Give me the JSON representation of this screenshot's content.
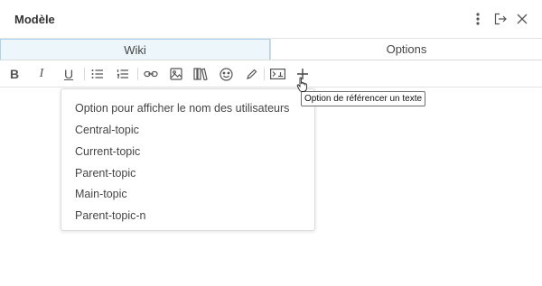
{
  "window": {
    "title": "Modèle",
    "icons": [
      "more-vertical-icon",
      "logout-icon",
      "close-icon"
    ]
  },
  "tabs": [
    {
      "label": "Wiki",
      "active": true
    },
    {
      "label": "Options",
      "active": false
    }
  ],
  "toolbar": {
    "bold": "B",
    "italic": "I",
    "underline": "U",
    "tools": [
      "bold-icon",
      "italic-icon",
      "underline-icon",
      "bullet-list-icon",
      "numbered-list-icon",
      "link-icon",
      "image-icon",
      "library-icon",
      "emoji-icon",
      "pencil-icon",
      "embed-icon",
      "plus-icon"
    ]
  },
  "tooltip": {
    "text": "Option de référencer un texte"
  },
  "dropdown": {
    "items": [
      "Option pour afficher le nom des utilisateurs",
      "Central-topic",
      "Current-topic",
      "Parent-topic",
      "Main-topic",
      "Parent-topic-n"
    ]
  },
  "colors": {
    "active_tab_bg": "#edf6fb",
    "active_tab_border": "#a8d4ec",
    "text": "#444444"
  }
}
